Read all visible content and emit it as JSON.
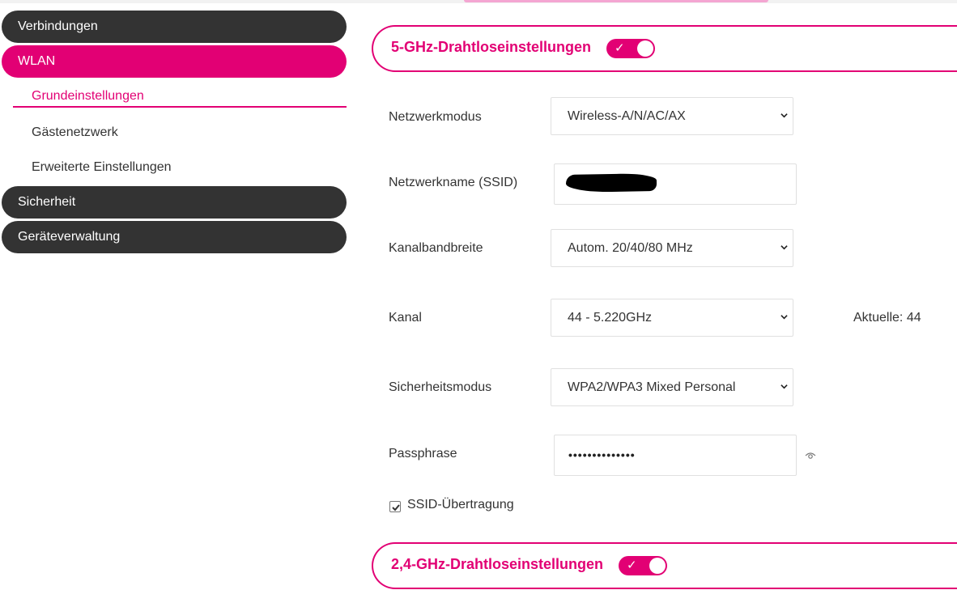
{
  "sidebar": {
    "items": [
      {
        "label": "Verbindungen",
        "active": false
      },
      {
        "label": "WLAN",
        "active": true
      },
      {
        "label": "Sicherheit",
        "active": false
      },
      {
        "label": "Geräteverwaltung",
        "active": false
      }
    ],
    "wlan_sub_items": [
      {
        "label": "Grundeinstellungen",
        "active": true
      },
      {
        "label": "Gästenetzwerk",
        "active": false
      },
      {
        "label": "Erweiterte Einstellungen",
        "active": false
      }
    ]
  },
  "band5": {
    "title": "5-GHz-Drahtloseinstellungen",
    "enabled": true,
    "toggle_check": "✓",
    "network_mode": {
      "label": "Netzwerkmodus",
      "value": "Wireless-A/N/AC/AX"
    },
    "ssid": {
      "label": "Netzwerkname (SSID)",
      "value_redacted": true
    },
    "bandwidth": {
      "label": "Kanalbandbreite",
      "value": "Autom. 20/40/80 MHz"
    },
    "channel": {
      "label": "Kanal",
      "value": "44 - 5.220GHz",
      "current": "Aktuelle: 44"
    },
    "security_mode": {
      "label": "Sicherheitsmodus",
      "value": "WPA2/WPA3 Mixed Personal"
    },
    "passphrase": {
      "label": "Passphrase",
      "value_masked": "••••••••••••••"
    },
    "ssid_broadcast": {
      "label": "SSID-Übertragung",
      "checked": true
    }
  },
  "band24": {
    "title": "2,4-GHz-Drahtloseinstellungen",
    "enabled": true,
    "toggle_check": "✓"
  },
  "colors": {
    "accent": "#e20074",
    "nav_dark": "#333333"
  },
  "icons": [
    "chevron-down-icon",
    "eye-icon",
    "checkmark-icon"
  ]
}
